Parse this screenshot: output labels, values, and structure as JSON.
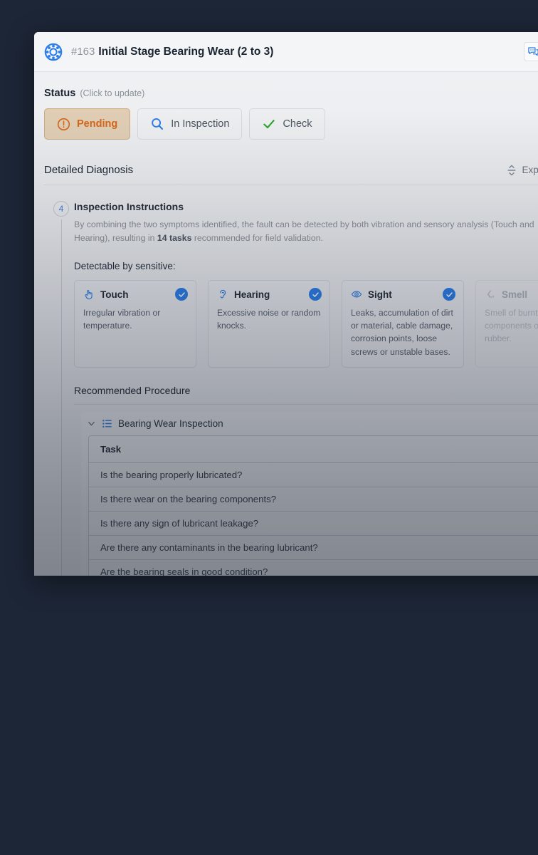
{
  "window": {
    "background_color": "#1d2637"
  },
  "header": {
    "logo_icon": "bearing-icon",
    "issue_id": "#163",
    "title": "Initial Stage Bearing Wear (2 to 3)",
    "actions": [
      {
        "name": "comments-button",
        "icon": "chat-bubble-icon"
      },
      {
        "name": "print-button",
        "icon": "printer-icon"
      }
    ]
  },
  "status": {
    "label": "Status",
    "hint": "(Click to update)",
    "options": [
      {
        "label": "Pending",
        "icon": "exclamation-circle-icon",
        "active": true
      },
      {
        "label": "In Inspection",
        "icon": "magnifier-icon",
        "active": false
      },
      {
        "label": "Check",
        "icon": "checkmark-icon",
        "active": false
      }
    ]
  },
  "diagnosis": {
    "title": "Detailed Diagnosis",
    "expand_label": "Expand S",
    "expand_icon": "expand-vertical-icon",
    "step": {
      "number": "4",
      "title": "Inspection Instructions",
      "description_part1": "By combining the two symptoms identified, the fault can be detected by both vibration and sensory analysis (Touch and Hearing), resulting in ",
      "description_emphasis": "14 tasks",
      "description_part2": " recommended for field validation."
    },
    "sensory_label": "Detectable by sensitive:",
    "sensory": [
      {
        "name": "Touch",
        "icon": "hand-touch-icon",
        "checked": true,
        "description": "Irregular vibration or temperature."
      },
      {
        "name": "Hearing",
        "icon": "ear-icon",
        "checked": true,
        "description": "Excessive noise or random knocks."
      },
      {
        "name": "Sight",
        "icon": "eye-icon",
        "checked": true,
        "description": "Leaks, accumulation of dirt or material, cable damage, corrosion points, loose screws or unstable bases."
      },
      {
        "name": "Smell",
        "icon": "nose-icon",
        "checked": false,
        "description": "Smell of burnt electronic components or burnt rubber."
      }
    ]
  },
  "procedure": {
    "title": "Recommended Procedure",
    "edit_icon": "pencil-edit-icon",
    "group": {
      "name": "Bearing Wear Inspection",
      "chevron_icon": "chevron-down-icon",
      "list_icon": "ordered-list-icon",
      "expanded": true
    },
    "table": {
      "column_header": "Task",
      "rows": [
        "Is the bearing properly lubricated?",
        "Is there wear on the bearing components?",
        "Is there any sign of lubricant leakage?",
        "Are there any contaminants in the bearing lubricant?",
        "Are the bearing seals in good condition?"
      ]
    }
  },
  "colors": {
    "accent_blue": "#2b7de9",
    "pending_orange": "#d3661a",
    "pending_bg": "#e0cdb4",
    "check_green": "#2aa329",
    "backdrop": "#1d2637"
  }
}
